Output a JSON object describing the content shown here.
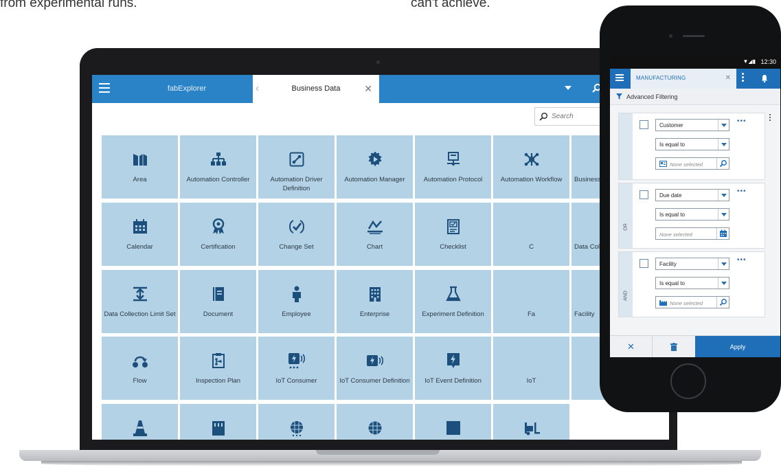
{
  "top_text": {
    "left": "from experimental runs.",
    "right": "can't achieve."
  },
  "laptop_app": {
    "app_tab": "fabExplorer",
    "active_tab": "Business Data",
    "search": {
      "placeholder": "Search",
      "value": ""
    },
    "tiles": [
      {
        "label": "Area",
        "icon": "area-icon"
      },
      {
        "label": "Automation Controller",
        "icon": "automation-controller-icon"
      },
      {
        "label": "Automation Driver Definition",
        "icon": "automation-driver-definition-icon"
      },
      {
        "label": "Automation Manager",
        "icon": "automation-manager-icon"
      },
      {
        "label": "Automation Protocol",
        "icon": "automation-protocol-icon"
      },
      {
        "label": "Automation Workflow",
        "icon": "automation-workflow-icon"
      },
      {
        "label": "Business Partner",
        "icon": "business-partner-icon"
      },
      {
        "label": "Calendar",
        "icon": "calendar-icon"
      },
      {
        "label": "Certification",
        "icon": "certification-icon"
      },
      {
        "label": "Change Set",
        "icon": "change-set-icon"
      },
      {
        "label": "Chart",
        "icon": "chart-icon"
      },
      {
        "label": "Checklist",
        "icon": "checklist-icon"
      },
      {
        "label": "C",
        "icon": ""
      },
      {
        "label": "Data Collection",
        "icon": "data-collection-icon"
      },
      {
        "label": "Data Collection Limit Set",
        "icon": "data-collection-limit-set-icon"
      },
      {
        "label": "Document",
        "icon": "document-icon"
      },
      {
        "label": "Employee",
        "icon": "employee-icon"
      },
      {
        "label": "Enterprise",
        "icon": "enterprise-icon"
      },
      {
        "label": "Experiment Definition",
        "icon": "experiment-definition-icon"
      },
      {
        "label": "Fa",
        "icon": ""
      },
      {
        "label": "Facility",
        "icon": "facility-icon"
      },
      {
        "label": "Flow",
        "icon": "flow-icon"
      },
      {
        "label": "Inspection Plan",
        "icon": "inspection-plan-icon"
      },
      {
        "label": "IoT Consumer",
        "icon": "iot-consumer-icon"
      },
      {
        "label": "IoT Consumer Definition",
        "icon": "iot-consumer-definition-icon"
      },
      {
        "label": "IoT Event Definition",
        "icon": "iot-event-definition-icon"
      },
      {
        "label": "IoT",
        "icon": ""
      },
      {
        "label": "",
        "icon": "gauge-icon"
      },
      {
        "label": "",
        "icon": "cone-icon"
      },
      {
        "label": "",
        "icon": "panel-icon"
      },
      {
        "label": "",
        "icon": "globe-grid-icon"
      },
      {
        "label": "",
        "icon": "globe-icon"
      },
      {
        "label": "",
        "icon": "square-icon"
      },
      {
        "label": "",
        "icon": "forklift-icon"
      }
    ]
  },
  "phone_app": {
    "status_time": "12:30",
    "title": "MANUFACTURING",
    "advanced_filtering": "Advanced Filtering",
    "filters": [
      {
        "field": "Customer",
        "operator": "Is equal to",
        "value_placeholder": "None selected",
        "connector": ""
      },
      {
        "field": "Due date",
        "operator": "Is equal to",
        "value_placeholder": "None selected",
        "connector": "OR"
      },
      {
        "field": "Facility",
        "operator": "Is equal to",
        "value_placeholder": "None selected",
        "connector": "AND"
      }
    ],
    "apply_label": "Apply"
  },
  "colors": {
    "header_blue": "#2a83c7",
    "tile_blue": "#b4d2e6",
    "icon_navy": "#1d4f7c",
    "phone_blue": "#1f6fb8"
  }
}
